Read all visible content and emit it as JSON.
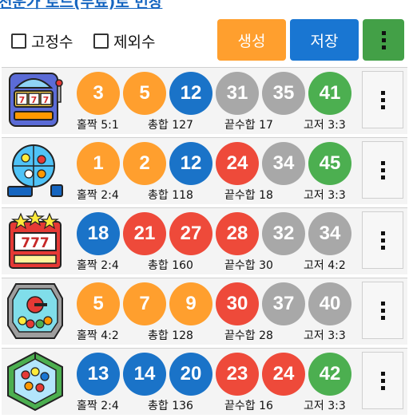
{
  "title": "천운가 로드(무료)로 번창",
  "toolbar": {
    "fixed_label": "고정수",
    "exclude_label": "제외수",
    "generate_label": "생성",
    "save_label": "저장"
  },
  "colors": {
    "orange": "#ff9f2e",
    "blue": "#1a73c8",
    "red": "#ee4a3a",
    "gray": "#a8a8a8",
    "green": "#4caf50"
  },
  "rows": [
    {
      "icon": "slot-machine-icon",
      "balls": [
        {
          "n": "3",
          "c": "orange"
        },
        {
          "n": "5",
          "c": "orange"
        },
        {
          "n": "12",
          "c": "blue"
        },
        {
          "n": "31",
          "c": "gray"
        },
        {
          "n": "35",
          "c": "gray"
        },
        {
          "n": "41",
          "c": "green"
        }
      ],
      "odd_even": "홀짝 5:1",
      "sum": "총합 127",
      "end_sum": "끝수합 17",
      "fixed": "고저 3:3"
    },
    {
      "icon": "lottery-drum-icon",
      "balls": [
        {
          "n": "1",
          "c": "orange"
        },
        {
          "n": "2",
          "c": "orange"
        },
        {
          "n": "12",
          "c": "blue"
        },
        {
          "n": "24",
          "c": "red"
        },
        {
          "n": "34",
          "c": "gray"
        },
        {
          "n": "45",
          "c": "green"
        }
      ],
      "odd_even": "홀짝 2:4",
      "sum": "총합 118",
      "end_sum": "끝수합 18",
      "fixed": "고저 3:3"
    },
    {
      "icon": "jackpot-777-icon",
      "balls": [
        {
          "n": "18",
          "c": "blue"
        },
        {
          "n": "21",
          "c": "red"
        },
        {
          "n": "27",
          "c": "red"
        },
        {
          "n": "28",
          "c": "red"
        },
        {
          "n": "32",
          "c": "gray"
        },
        {
          "n": "34",
          "c": "gray"
        }
      ],
      "odd_even": "홀짝 2:4",
      "sum": "총합 160",
      "end_sum": "끝수합 30",
      "fixed": "고저 4:2"
    },
    {
      "icon": "lottery-machine-icon",
      "balls": [
        {
          "n": "5",
          "c": "orange"
        },
        {
          "n": "7",
          "c": "orange"
        },
        {
          "n": "9",
          "c": "orange"
        },
        {
          "n": "30",
          "c": "red"
        },
        {
          "n": "37",
          "c": "gray"
        },
        {
          "n": "40",
          "c": "gray"
        }
      ],
      "odd_even": "홀짝 4:2",
      "sum": "총합 128",
      "end_sum": "끝수합 28",
      "fixed": "고저 3:3"
    },
    {
      "icon": "ball-box-icon",
      "balls": [
        {
          "n": "13",
          "c": "blue"
        },
        {
          "n": "14",
          "c": "blue"
        },
        {
          "n": "20",
          "c": "blue"
        },
        {
          "n": "23",
          "c": "red"
        },
        {
          "n": "24",
          "c": "red"
        },
        {
          "n": "42",
          "c": "green"
        }
      ],
      "odd_even": "홀짝 2:4",
      "sum": "총합 136",
      "end_sum": "끝수합 16",
      "fixed": "고저 3:3"
    }
  ]
}
